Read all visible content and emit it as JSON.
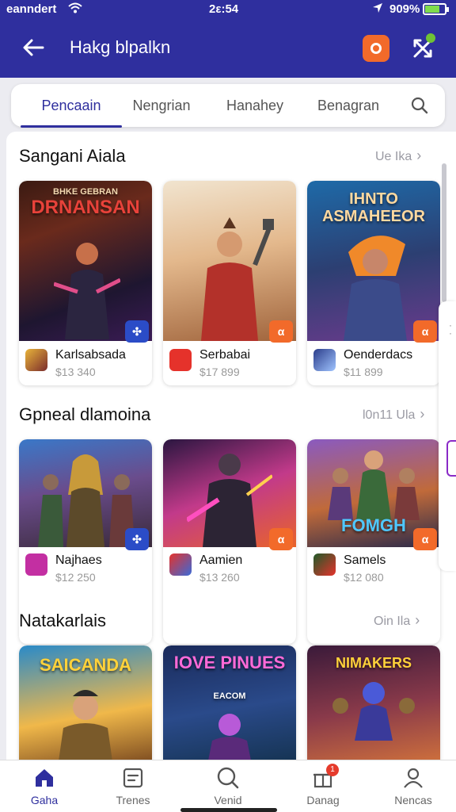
{
  "status_bar": {
    "carrier": "eanndert",
    "time": "2ε:54",
    "battery": "909%"
  },
  "header": {
    "title": "Hakg blpalkn"
  },
  "tabs": [
    {
      "label": "Pencaain",
      "active": true
    },
    {
      "label": "Nengrian"
    },
    {
      "label": "Hanahey"
    },
    {
      "label": "Benagran"
    }
  ],
  "sections": [
    {
      "title": "Sangani Aiala",
      "see_more": "Ue Ika",
      "cards": [
        {
          "art_title": "DRNANSAN",
          "art_sub": "BHKE GEBRAN",
          "name": "Karlsabsada",
          "price": "$13 340",
          "badge": "blue"
        },
        {
          "art_title": "",
          "art_sub": "",
          "name": "Serbabai",
          "price": "$17 899",
          "badge": "orange"
        },
        {
          "art_title": "IHNTO ASMAHEEOR",
          "art_sub": "",
          "name": "Oenderdacs",
          "price": "$11 899",
          "badge": "orange"
        }
      ]
    },
    {
      "title": "Gpneal dlamoina",
      "see_more": "l0n11 Ula",
      "cards": [
        {
          "art_title": "",
          "art_sub": "",
          "name": "Najhaes",
          "price": "$12 250",
          "badge": "blue"
        },
        {
          "art_title": "",
          "art_sub": "",
          "name": "Aamien",
          "price": "$13 260",
          "badge": "orange"
        },
        {
          "art_title": "FOMGH",
          "art_sub": "",
          "name": "Samels",
          "price": "$12 080",
          "badge": "orange"
        }
      ]
    },
    {
      "title": "Natakarlais",
      "see_more": "Oin Ila",
      "cards": [
        {
          "art_title": "SAICANDA",
          "art_sub": "",
          "name": "",
          "price": "",
          "badge": ""
        },
        {
          "art_title": "IOVE PINUES",
          "art_sub": "EACOM",
          "name": "",
          "price": "",
          "badge": ""
        },
        {
          "art_title": "NIMAKERS",
          "art_sub": "",
          "name": "",
          "price": "",
          "badge": ""
        }
      ]
    }
  ],
  "bottom_nav": [
    {
      "label": "Gaha",
      "icon": "home-icon",
      "active": true
    },
    {
      "label": "Trenes",
      "icon": "list-icon"
    },
    {
      "label": "Venid",
      "icon": "search-icon"
    },
    {
      "label": "Danag",
      "icon": "gift-icon",
      "badge": "1"
    },
    {
      "label": "Nencas",
      "icon": "profile-icon"
    }
  ],
  "colors": {
    "primary": "#2f2f9e",
    "accent": "#f26a2a",
    "badge_blue": "#2b4cc7"
  }
}
